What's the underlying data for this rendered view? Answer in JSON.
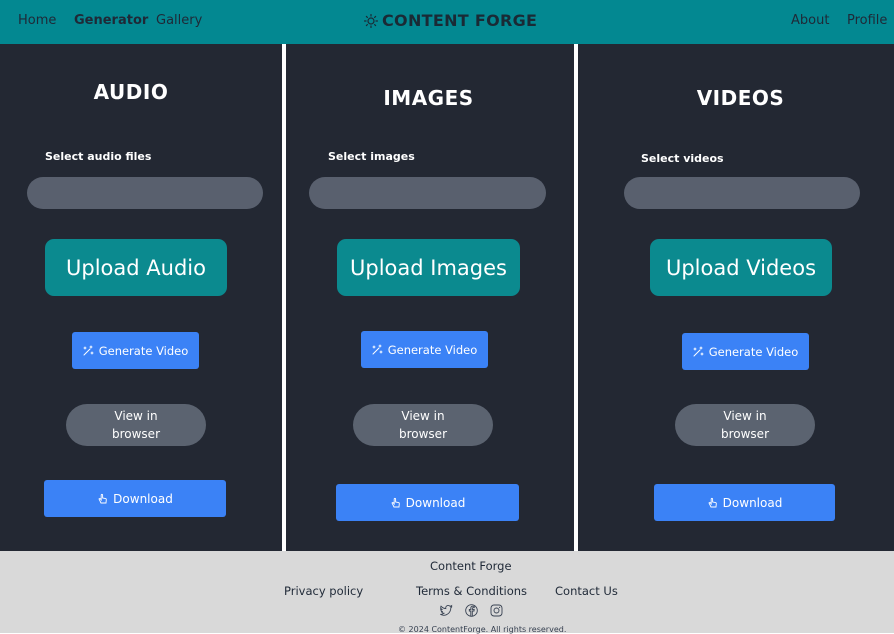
{
  "nav": {
    "home": "Home",
    "generator": "Generator",
    "gallery": "Gallery",
    "brand": "CONTENT FORGE",
    "about": "About",
    "profile": "Profile"
  },
  "panels": [
    {
      "title": "AUDIO",
      "select_label": "Select audio files",
      "upload": "Upload Audio",
      "generate": "Generate Video",
      "view": "View in browser",
      "download": "Download"
    },
    {
      "title": "IMAGES",
      "select_label": "Select images",
      "upload": "Upload Images",
      "generate": "Generate Video",
      "view": "View in browser",
      "download": "Download"
    },
    {
      "title": "VIDEOS",
      "select_label": "Select videos",
      "upload": "Upload Videos",
      "generate": "Generate Video",
      "view": "View in browser",
      "download": "Download"
    }
  ],
  "footer": {
    "name": "Content Forge",
    "privacy": "Privacy policy",
    "terms": "Terms & Conditions",
    "contact": "Contact Us",
    "copyright": "© 2024 ContentForge. All rights reserved.",
    "social_icons": [
      "twitter-icon",
      "facebook-icon",
      "instagram-icon"
    ]
  },
  "colors": {
    "nav": "#038891",
    "panel": "#232833",
    "upload": "#0b8a8f",
    "primary": "#3b82f6",
    "view": "#5b6370",
    "footer": "#d9d9d9"
  }
}
